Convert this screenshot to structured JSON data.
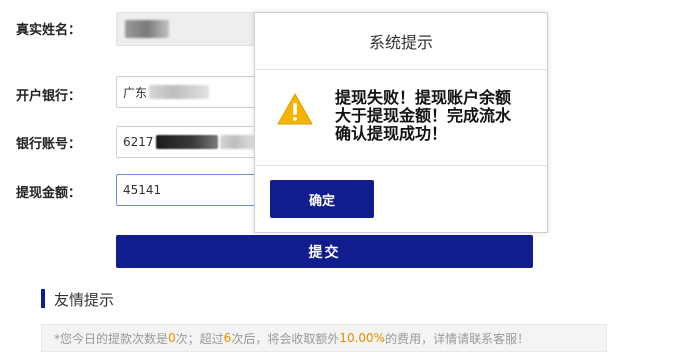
{
  "form": {
    "name_label": "真实姓名：",
    "bank_label": "开户银行：",
    "bank_value_visible": "广东",
    "account_label": "银行账号：",
    "account_value_visible": "6217",
    "amount_label": "提现金额：",
    "amount_value": "45141",
    "submit_label": "提交"
  },
  "tips": {
    "title": "友情提示",
    "notice_prefix": "*您今日的提款次数是",
    "count_today": "0",
    "notice_mid1": "次；超过",
    "count_limit": "6",
    "notice_mid2": "次后，将会收取额外",
    "fee_percent": "10.00%",
    "notice_suffix": "的费用，详情请联系客服！"
  },
  "dialog": {
    "title": "系统提示",
    "message": "提现失败！提现账户余额大于提现金额！完成流水确认提现成功！",
    "confirm_label": "确定",
    "icon": "warning-icon"
  },
  "colors": {
    "primary": "#111d8e",
    "warning": "#f5b400",
    "highlight": "#f08c00"
  }
}
